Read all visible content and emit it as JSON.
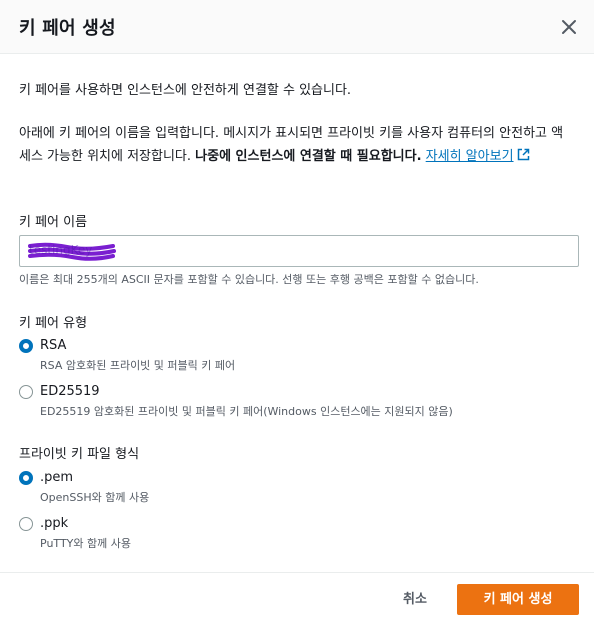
{
  "dialog": {
    "title": "키 페어 생성",
    "intro": "키 페어를 사용하면 인스턴스에 안전하게 연결할 수 있습니다.",
    "description": "아래에 키 페어의 이름을 입력합니다. 메시지가 표시되면 프라이빗 키를 사용자 컴퓨터의 안전하고 액세스 가능한 위치에 저장합니다. ",
    "description_bold": "나중에 인스턴스에 연결할 때 필요합니다.",
    "learn_more": "자세히 알아보기"
  },
  "name_field": {
    "label": "키 페어 이름",
    "value": "testingKey",
    "hint": "이름은 최대 255개의 ASCII 문자를 포함할 수 있습니다. 선행 또는 후행 공백은 포함할 수 없습니다."
  },
  "key_type": {
    "label": "키 페어 유형",
    "options": [
      {
        "label": "RSA",
        "desc": "RSA 암호화된 프라이빗 및 퍼블릭 키 페어",
        "selected": true
      },
      {
        "label": "ED25519",
        "desc": "ED25519 암호화된 프라이빗 및 퍼블릭 키 페어(Windows 인스턴스에는 지원되지 않음)",
        "selected": false
      }
    ]
  },
  "file_format": {
    "label": "프라이빗 키 파일 형식",
    "options": [
      {
        "label": ".pem",
        "desc": "OpenSSH와 함께 사용",
        "selected": true
      },
      {
        "label": ".ppk",
        "desc": "PuTTY와 함께 사용",
        "selected": false
      }
    ]
  },
  "footer": {
    "cancel": "취소",
    "create": "키 페어 생성"
  },
  "colors": {
    "accent": "#0073bb",
    "primary_button": "#ec7211",
    "redaction": "#7a1fd0"
  },
  "icons": {
    "close": "close-icon",
    "external": "external-link-icon"
  }
}
